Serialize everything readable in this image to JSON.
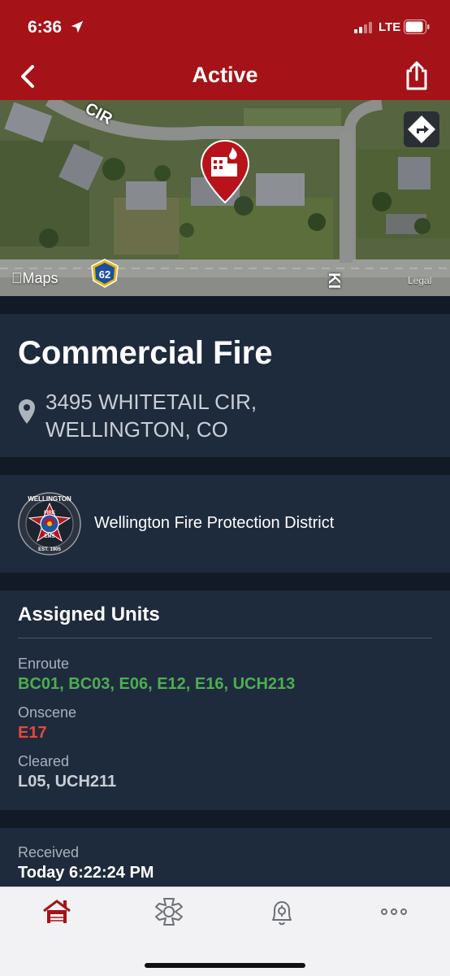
{
  "status_bar": {
    "time": "6:36",
    "network": "LTE",
    "icons": [
      "location-arrow-icon",
      "signal-icon",
      "battery-icon"
    ]
  },
  "nav": {
    "title": "Active",
    "back_icon": "chevron-left-icon",
    "share_icon": "share-icon"
  },
  "map": {
    "attribution": "Maps",
    "legal": "Legal",
    "highway_number": "62",
    "street_label_1": "CIR",
    "street_label_2": "KI",
    "directions_icon": "directions-icon",
    "marker_icon": "building-fire-icon"
  },
  "incident": {
    "type": "Commercial Fire",
    "address_line1": "3495 WHITETAIL CIR,",
    "address_line2": "WELLINGTON, CO"
  },
  "agency": {
    "name": "Wellington Fire Protection District",
    "logo_top": "WELLINGTON",
    "logo_fire": "FIRE",
    "logo_ems": "EMS",
    "logo_est": "EST. 1905"
  },
  "units": {
    "title": "Assigned Units",
    "enroute_label": "Enroute",
    "enroute": "BC01, BC03, E06, E12, E16, UCH213",
    "onscene_label": "Onscene",
    "onscene": "E17",
    "cleared_label": "Cleared",
    "cleared": "L05, UCH211"
  },
  "received": {
    "label": "Received",
    "value": "Today 6:22:24 PM"
  },
  "tabs": [
    {
      "name": "home",
      "icon": "firehouse-icon",
      "active": true
    },
    {
      "name": "incidents",
      "icon": "maltese-cross-icon",
      "active": false
    },
    {
      "name": "alerts",
      "icon": "bell-gear-icon",
      "active": false
    },
    {
      "name": "more",
      "icon": "more-dots-icon",
      "active": false
    }
  ],
  "colors": {
    "brand_red": "#a51318",
    "card_bg": "#1e2b3c",
    "enroute": "#4caf50",
    "onscene": "#e8483a"
  }
}
